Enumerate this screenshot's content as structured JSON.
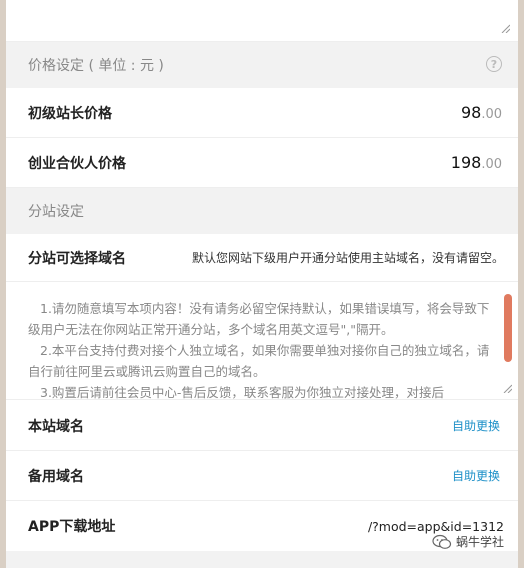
{
  "pricing": {
    "section_title": "价格设定 ( 单位 : 元 )",
    "help_icon_glyph": "?",
    "rows": [
      {
        "label": "初级站长价格",
        "value": "98",
        "cents": ".00"
      },
      {
        "label": "创业合伙人价格",
        "value": "198",
        "cents": ".00"
      }
    ]
  },
  "substation": {
    "section_title": "分站设定",
    "domain_label": "分站可选择域名",
    "domain_hint": "默认您网站下级用户开通分站使用主站域名，没有请留空。",
    "notice_lines": [
      "1.请勿随意填写本项内容！没有请务必留空保持默认，如果错误填写，将会导致下级用户无法在你网站正常开通分站，多个域名用英文逗号\",\"隔开。",
      "2.本平台支持付费对接个人独立域名，如果你需要单独对接你自己的独立域名，请自行前往阿里云或腾讯云购置自己的域名。",
      "3.购置后请前往会员中心-售后反馈，联系客服为你独立对接处理，对接后"
    ],
    "local_domain_label": "本站域名",
    "backup_domain_label": "备用域名",
    "change_link": "自助更换",
    "app_label": "APP下载地址",
    "app_url": "/?mod=app&id=1312"
  },
  "watermark": {
    "text": "蜗牛学社"
  },
  "colors": {
    "link": "#1e90c8",
    "scroll_thumb": "#e07a5f",
    "section_bg": "#f2f2f2"
  }
}
